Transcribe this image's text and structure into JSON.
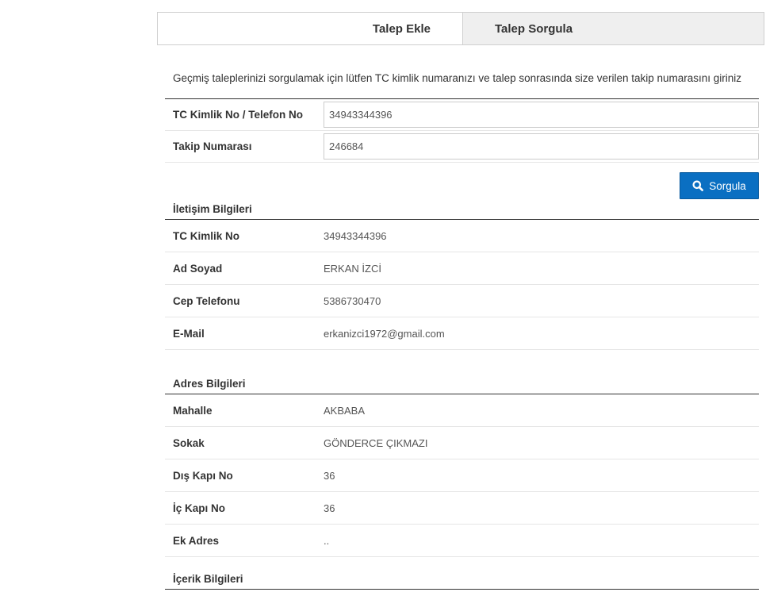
{
  "tabs": [
    {
      "label": "Talep Ekle",
      "active": true
    },
    {
      "label": "Talep Sorgula",
      "active": false
    }
  ],
  "info_text": "Geçmiş taleplerinizi sorgulamak için lütfen TC kimlik numaranızı ve talep sonrasında size verilen takip numarasını giriniz",
  "form": {
    "tc_label": "TC Kimlik No / Telefon No",
    "tc_value": "34943344396",
    "takip_label": "Takip Numarası",
    "takip_value": "246684",
    "submit_label": "Sorgula"
  },
  "iletisim": {
    "title": "İletişim Bilgileri",
    "rows": [
      {
        "label": "TC Kimlik No",
        "value": "34943344396"
      },
      {
        "label": "Ad Soyad",
        "value": "ERKAN İZCİ"
      },
      {
        "label": "Cep Telefonu",
        "value": "5386730470"
      },
      {
        "label": "E-Mail",
        "value": "erkanizci1972@gmail.com"
      }
    ]
  },
  "adres": {
    "title": "Adres Bilgileri",
    "rows": [
      {
        "label": "Mahalle",
        "value": "AKBABA"
      },
      {
        "label": "Sokak",
        "value": "GÖNDERCE ÇIKMAZI"
      },
      {
        "label": "Dış Kapı No",
        "value": "36"
      },
      {
        "label": "İç Kapı No",
        "value": "36"
      },
      {
        "label": "Ek Adres",
        "value": ".."
      }
    ]
  },
  "icerik": {
    "title": "İçerik Bilgileri"
  },
  "colors": {
    "primary_button": "#0a6fc2",
    "inactive_tab": "#efefef"
  }
}
